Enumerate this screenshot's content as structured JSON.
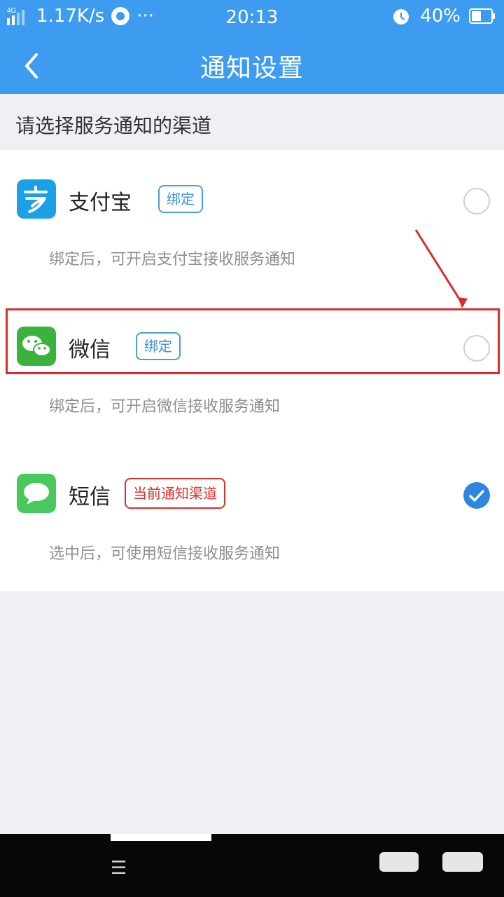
{
  "status_bar": {
    "network": "4G",
    "speed": "1.17K/s",
    "more": "···",
    "time": "20:13",
    "battery": "40%",
    "icons": [
      "signal-icon",
      "app-notification-icon",
      "alarm-icon",
      "battery-icon"
    ]
  },
  "nav": {
    "title": "通知设置",
    "back_icon": "back-arrow-icon"
  },
  "section": {
    "title": "请选择服务通知的渠道"
  },
  "channels": [
    {
      "name": "支付宝",
      "badge": "绑定",
      "desc": "绑定后，可开启支付宝接收服务通知",
      "selected": false,
      "icon": "alipay-icon"
    },
    {
      "name": "微信",
      "badge": "绑定",
      "desc": "绑定后，可开启微信接收服务通知",
      "selected": false,
      "icon": "wechat-icon"
    },
    {
      "name": "短信",
      "badge": "当前通知渠道",
      "desc": "选中后，可使用短信接收服务通知",
      "selected": true,
      "icon": "sms-icon"
    }
  ],
  "bottom_nav": {
    "menu": "☰"
  }
}
